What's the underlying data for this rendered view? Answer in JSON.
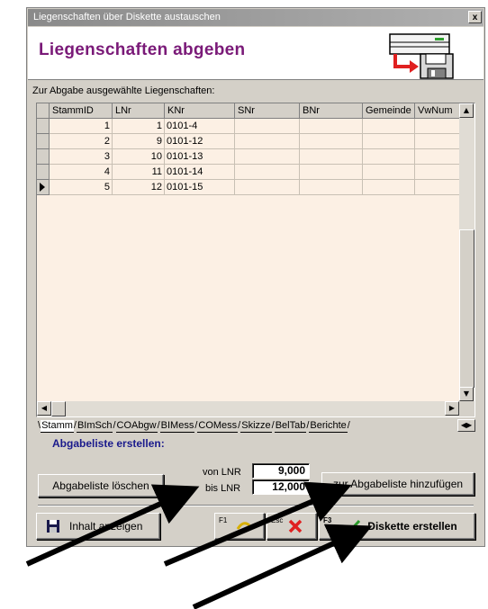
{
  "window": {
    "title": "Liegenschaften über Diskette austauschen",
    "close_label": "x"
  },
  "header": {
    "heading": "Liegenschaften abgeben",
    "icon": "diskette-transfer-icon"
  },
  "grid": {
    "label": "Zur Abgabe ausgewählte Liegenschaften:",
    "columns": [
      "StammID",
      "LNr",
      "KNr",
      "SNr",
      "BNr",
      "Gemeinde",
      "VwNum"
    ],
    "rows": [
      {
        "StammID": "1",
        "LNr": "1",
        "KNr": "0101-4"
      },
      {
        "StammID": "2",
        "LNr": "9",
        "KNr": "0101-12"
      },
      {
        "StammID": "3",
        "LNr": "10",
        "KNr": "0101-13"
      },
      {
        "StammID": "4",
        "LNr": "11",
        "KNr": "0101-14"
      },
      {
        "StammID": "5",
        "LNr": "12",
        "KNr": "0101-15"
      }
    ],
    "current_row_index": 4
  },
  "tabs": [
    "Stamm",
    "BImSch",
    "COAbgw",
    "BIMess",
    "COMess",
    "Skizze",
    "BelTab",
    "Berichte"
  ],
  "abgabe": {
    "section_title": "Abgabeliste erstellen:",
    "clear_button": "Abgabeliste löschen",
    "von_label": "von LNR",
    "von_value": "9,000",
    "bis_label": "bis LNR",
    "bis_value": "12,000",
    "add_button": "zur Abgabeliste hinzufügen"
  },
  "bottom": {
    "show_button": "Inhalt anzeigen",
    "f1_key": "F1",
    "esc_key": "Esc",
    "f3_key": "F3",
    "create_button": "Diskette erstellen"
  },
  "colors": {
    "heading": "#7a1a78",
    "section_title": "#1a1a8c",
    "grid_background": "#fcf0e4",
    "cancel_icon": "#e02020",
    "confirm_icon": "#2a9a2a"
  }
}
